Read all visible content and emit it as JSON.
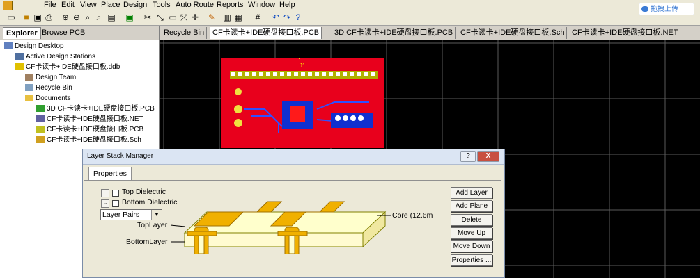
{
  "menu": [
    "File",
    "Edit",
    "View",
    "Place",
    "Design",
    "Tools",
    "Auto Route",
    "Reports",
    "Window",
    "Help"
  ],
  "upload_label": "拖拽上传",
  "explorer": {
    "tabs": [
      "Explorer",
      "Browse PCB"
    ],
    "tree": [
      "Design Desktop",
      "Active Design Stations",
      "CF卡读卡+IDE硬盘接口板.ddb",
      "Design Team",
      "Recycle Bin",
      "Documents",
      "3D CF卡读卡+IDE硬盘接口板.PCB",
      "CF卡读卡+IDE硬盘接口板.NET",
      "CF卡读卡+IDE硬盘接口板.PCB",
      "CF卡读卡+IDE硬盘接口板.Sch"
    ]
  },
  "doc_tabs": [
    "Recycle Bin",
    "CF卡读卡+IDE硬盘接口板.PCB",
    "3D CF卡读卡+IDE硬盘接口板.PCB",
    "CF卡读卡+IDE硬盘接口板.Sch",
    "CF卡读卡+IDE硬盘接口板.NET"
  ],
  "pcb_label": "J1",
  "dialog": {
    "title": "Layer Stack Manager",
    "help_btn": "?",
    "close_btn": "X",
    "tab": "Properties",
    "top_dielectric": "Top Dielectric",
    "bottom_dielectric": "Bottom Dielectric",
    "layer_pairs": "Layer Pairs",
    "top_layer": "TopLayer",
    "bottom_layer": "BottomLayer",
    "core": "Core (12.6m",
    "buttons": [
      "Add Layer",
      "Add Plane",
      "Delete",
      "Move Up",
      "Move Down",
      "Properties ..."
    ]
  },
  "colors": {
    "pcb_red": "#e8001c",
    "copper": "#f0b000",
    "grid": "#5a5a5a"
  }
}
